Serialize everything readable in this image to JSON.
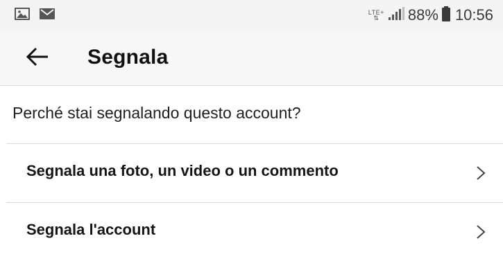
{
  "status_bar": {
    "network": "LTE+",
    "battery_percent": "88%",
    "time": "10:56",
    "left_icons": [
      "image-notification-icon",
      "email-notification-icon"
    ],
    "right_icons": [
      "lte-data-icon",
      "signal-icon",
      "battery-icon"
    ]
  },
  "header": {
    "title": "Segnala",
    "back_icon": "arrow-left-icon"
  },
  "main": {
    "question": "Perché stai segnalando questo account?",
    "options": [
      {
        "label": "Segnala una foto, un video o un commento",
        "icon": "chevron-right-icon"
      },
      {
        "label": "Segnala l'account",
        "icon": "chevron-right-icon"
      }
    ]
  },
  "colors": {
    "status_bar_bg": "#f4f4f4",
    "app_bar_bg": "#f7f7f7",
    "divider": "#dcdcdc",
    "text": "#151515"
  }
}
